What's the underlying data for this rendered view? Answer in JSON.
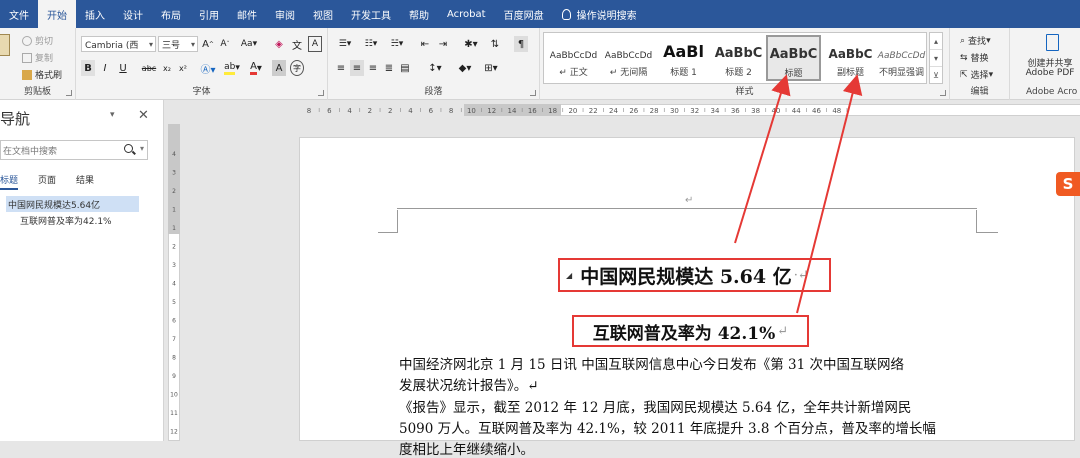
{
  "tabs": [
    "文件",
    "开始",
    "插入",
    "设计",
    "布局",
    "引用",
    "邮件",
    "审阅",
    "视图",
    "开发工具",
    "帮助",
    "Acrobat",
    "百度网盘",
    "操作说明搜索"
  ],
  "active_tab": "开始",
  "clipboard": {
    "cut": "剪切",
    "copy": "复制",
    "format_painter": "格式刷",
    "label": "剪贴板"
  },
  "font": {
    "name": "Cambria (西",
    "size": "三号",
    "label": "字体"
  },
  "paragraph": {
    "label": "段落"
  },
  "styles": {
    "label": "样式",
    "items": [
      {
        "preview": "AaBbCcDd",
        "name": "↵ 正文"
      },
      {
        "preview": "AaBbCcDd",
        "name": "↵ 无间隔"
      },
      {
        "preview": "AaBl",
        "name": "标题 1"
      },
      {
        "preview": "AaBbC",
        "name": "标题 2"
      },
      {
        "preview": "AaBbC",
        "name": "标题"
      },
      {
        "preview": "AaBbC",
        "name": "副标题"
      },
      {
        "preview": "AaBbCcDd",
        "name": "不明显强调"
      }
    ]
  },
  "editing": {
    "find": "查找",
    "replace": "替换",
    "select": "选择",
    "label": "编辑"
  },
  "adobe": {
    "button": "创建并共享 Adobe PDF",
    "line1": "创建并共享",
    "line2": "Adobe PDF",
    "label": "Adobe Acro"
  },
  "nav": {
    "title": "导航",
    "search_placeholder": "在文档中搜索",
    "tabs": [
      "标题",
      "页面",
      "结果"
    ],
    "headings": [
      "中国网民规模达5.64亿",
      "互联网普及率为42.1%"
    ]
  },
  "document": {
    "header_mark": "↵",
    "title": "中国网民规模达 5.64 亿",
    "subtitle": "互联网普及率为 42.1%",
    "para1_line1": "中国经济网北京 1 月 15 日讯 中国互联网信息中心今日发布《第 31 次中国互联网络",
    "para1_line2": "发展状况统计报告》。↵",
    "para2_line1": "《报告》显示，截至 2012 年 12 月底，我国网民规模达 5.64 亿，全年共计新增网民",
    "para2_line2": "5090 万人。互联网普及率为 42.1%，较 2011 年底提升 3.8 个百分点，普及率的增长幅",
    "para2_line3": "度相比上年继续缩小。"
  },
  "ruler": {
    "marks": [
      "8",
      "6",
      "4",
      "2",
      "2",
      "4",
      "6",
      "8",
      "10",
      "12",
      "14",
      "16",
      "18",
      "20",
      "22",
      "24",
      "26",
      "28",
      "30",
      "32",
      "34",
      "36",
      "38",
      "40",
      "44",
      "46",
      "48"
    ],
    "vmarks": [
      "4",
      "3",
      "2",
      "1",
      "1",
      "2",
      "3",
      "4",
      "5",
      "6",
      "7",
      "8",
      "9",
      "10",
      "11",
      "12"
    ]
  },
  "sogou": "S",
  "colors": {
    "accent": "#2b579a",
    "annotation": "#e53935",
    "font_red": "#e53935",
    "highlight_yellow": "#ffeb3b"
  }
}
